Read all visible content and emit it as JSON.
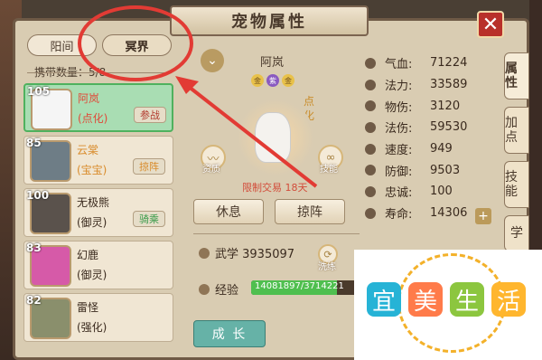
{
  "window": {
    "title": "宠物属性",
    "close_icon": "close-icon",
    "close_glyph": "✕"
  },
  "left_tabs": [
    "阳间",
    "冥界"
  ],
  "carry": {
    "label": "携带数量：5/8"
  },
  "pets": [
    {
      "level": "105",
      "name": "阿岚",
      "type": "(点化)",
      "badge": "参战",
      "selected": true,
      "avatar_color": "#f5f5f5",
      "name_color": "#e04a3a",
      "type_color": "#e04a3a",
      "badge_color": "#b23b2f"
    },
    {
      "level": "85",
      "name": "云棠",
      "type": "(宝宝)",
      "badge": "掠阵",
      "selected": false,
      "avatar_color": "#6e7d86",
      "name_color": "#d98b2a",
      "type_color": "#d98b2a",
      "badge_color": "#d98b2a"
    },
    {
      "level": "100",
      "name": "无极熊",
      "type": "(御灵)",
      "badge": "骑乘",
      "selected": false,
      "avatar_color": "#5a524c",
      "name_color": "#3a2a1e",
      "type_color": "#3a2a1e",
      "badge_color": "#3a9b4a"
    },
    {
      "level": "83",
      "name": "幻鹿",
      "type": "(御灵)",
      "badge": "",
      "selected": false,
      "avatar_color": "#d65aa8",
      "name_color": "#3a2a1e",
      "type_color": "#3a2a1e",
      "badge_color": "#3a2a1e"
    },
    {
      "level": "82",
      "name": "雷怪",
      "type": "(强化)",
      "badge": "",
      "selected": false,
      "avatar_color": "#8a8f6c",
      "name_color": "#3a2a1e",
      "type_color": "#3a2a1e",
      "badge_color": "#3a2a1e"
    }
  ],
  "pet_detail": {
    "name": "阿岚",
    "stars": [
      "金",
      "紫",
      "金"
    ],
    "dianhua": "点化",
    "limit_text": "限制交易 18天",
    "left_icon_label": "资质",
    "right_icon_label": "技能",
    "rest_button": "休息",
    "lueze_button": "掠阵",
    "martial": "武学 3935097",
    "exp_label": "经验",
    "exp_text": "14081897/3714221",
    "exp_fraction": 0.75,
    "grow_button": "成 长",
    "exchange_label": "洗练"
  },
  "stats": [
    {
      "label": "气血:",
      "value": "71224"
    },
    {
      "label": "法力:",
      "value": "33589"
    },
    {
      "label": "物伤:",
      "value": "3120"
    },
    {
      "label": "法伤:",
      "value": "59530"
    },
    {
      "label": "速度:",
      "value": "949"
    },
    {
      "label": "防御:",
      "value": "9503"
    },
    {
      "label": "忠诚:",
      "value": "100"
    },
    {
      "label": "寿命:",
      "value": "14306"
    }
  ],
  "right_tabs": [
    "属性",
    "加点",
    "技能",
    "学"
  ],
  "watermark": [
    "宜",
    "美",
    "生",
    "活"
  ]
}
